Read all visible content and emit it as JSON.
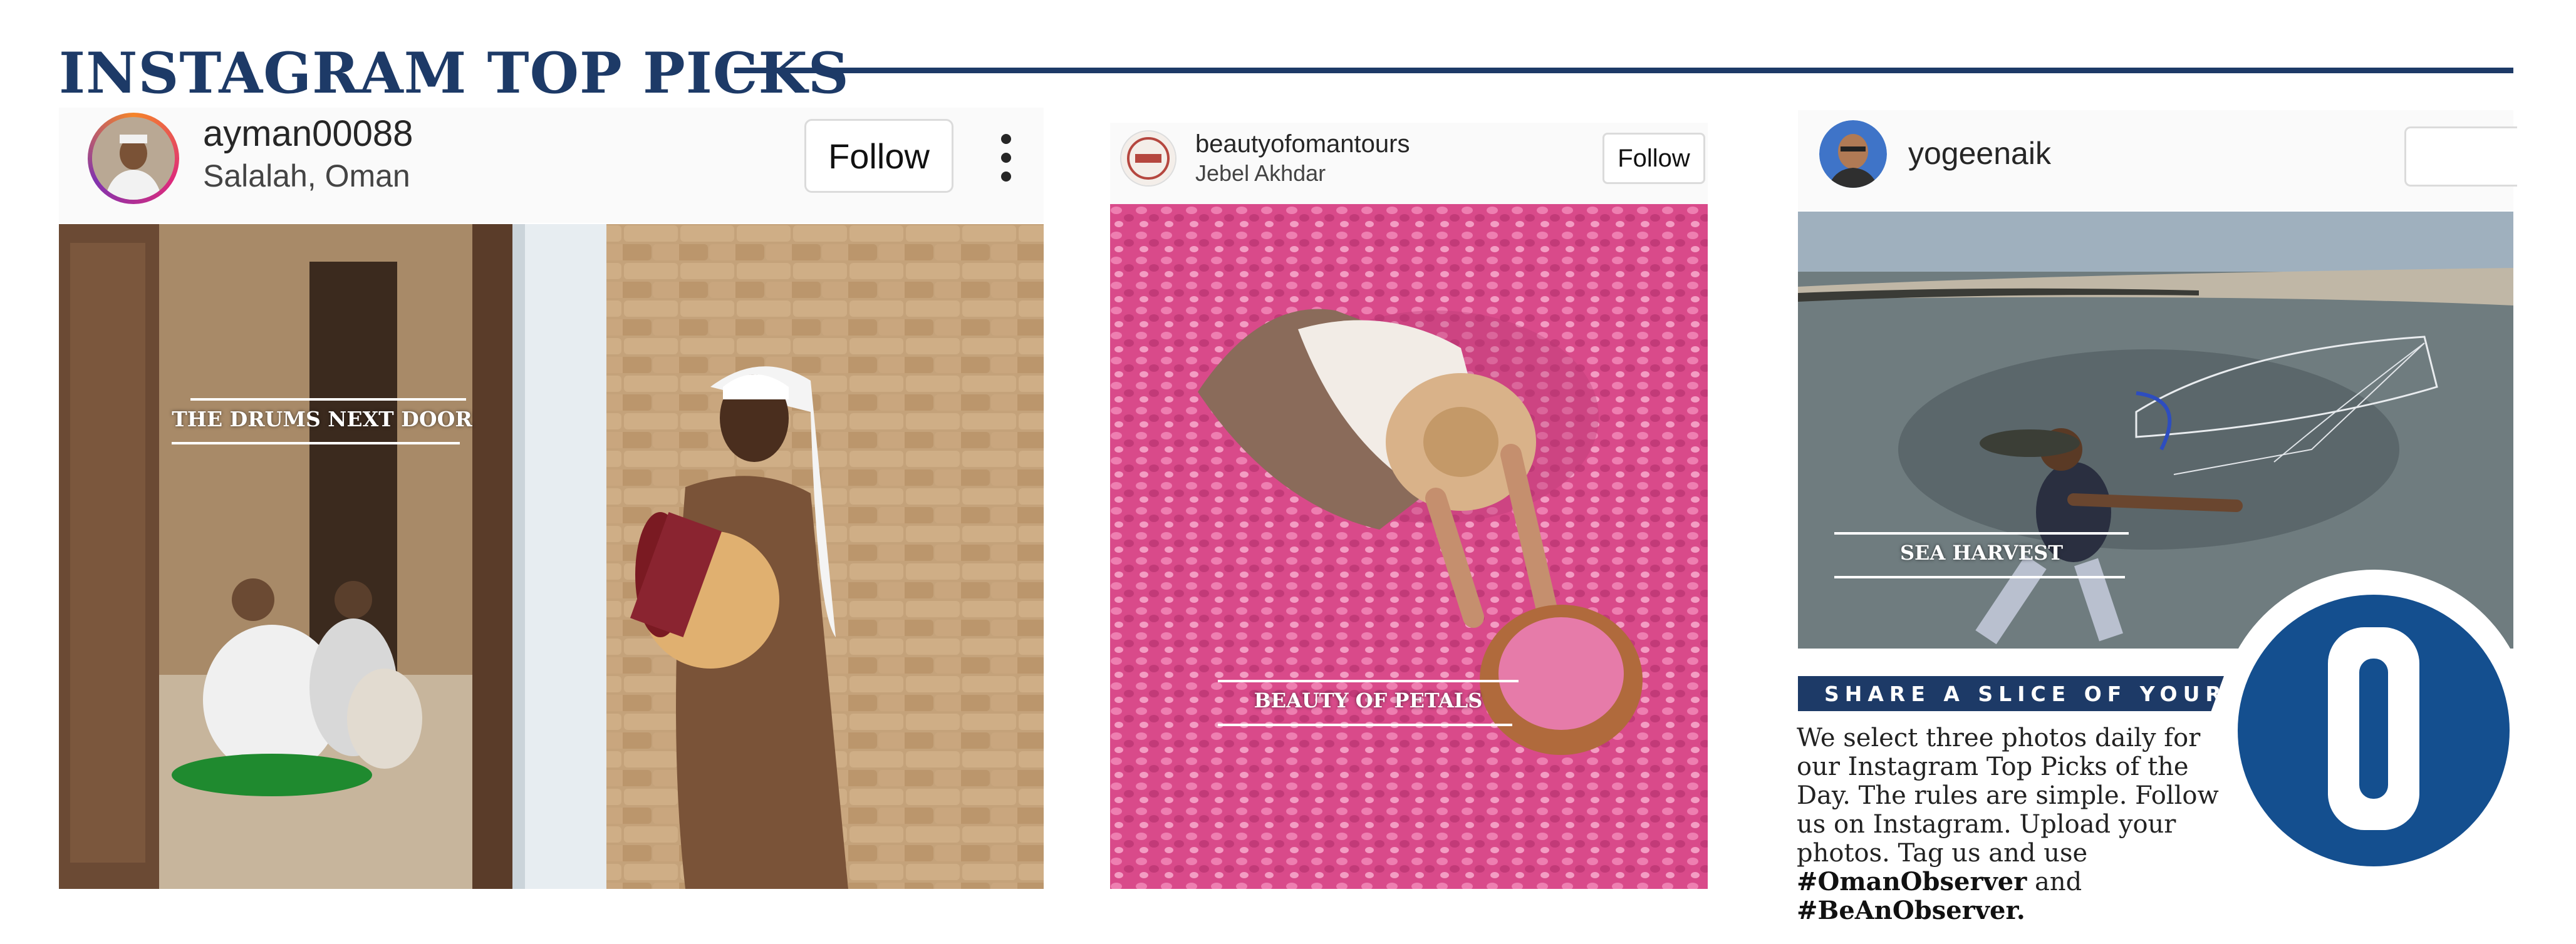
{
  "page": {
    "title": "INSTAGRAM TOP PICKS",
    "colors": {
      "navy": "#1d3a67",
      "logo_blue": "#144f8f"
    }
  },
  "posts": [
    {
      "username": "ayman00088",
      "location": "Salalah, Oman",
      "follow_label": "Follow",
      "caption": "THE DRUMS NEXT DOOR",
      "has_more_menu": true
    },
    {
      "username": "beautyofomantours",
      "location": "Jebel Akhdar",
      "follow_label": "Follow",
      "caption": "BEAUTY OF PETALS"
    },
    {
      "username": "yogeenaik",
      "location": "",
      "caption": "SEA HARVEST"
    }
  ],
  "promo": {
    "banner": "SHARE A SLICE OF YOUR LIFE",
    "body_line1": "We select three photos daily for",
    "body_line2": "our Instagram Top Picks of the",
    "body_line3": "Day. The rules are simple. Follow",
    "body_line4": "us on Instagram. Upload your",
    "body_line5": "photos. Tag us and use",
    "hashtag1": "#OmanObserver",
    "and_word": "and",
    "hashtag2": "#BeAnObserver."
  },
  "icons": {
    "more": "more-vertical-icon",
    "logo": "oman-observer-o-logo"
  }
}
